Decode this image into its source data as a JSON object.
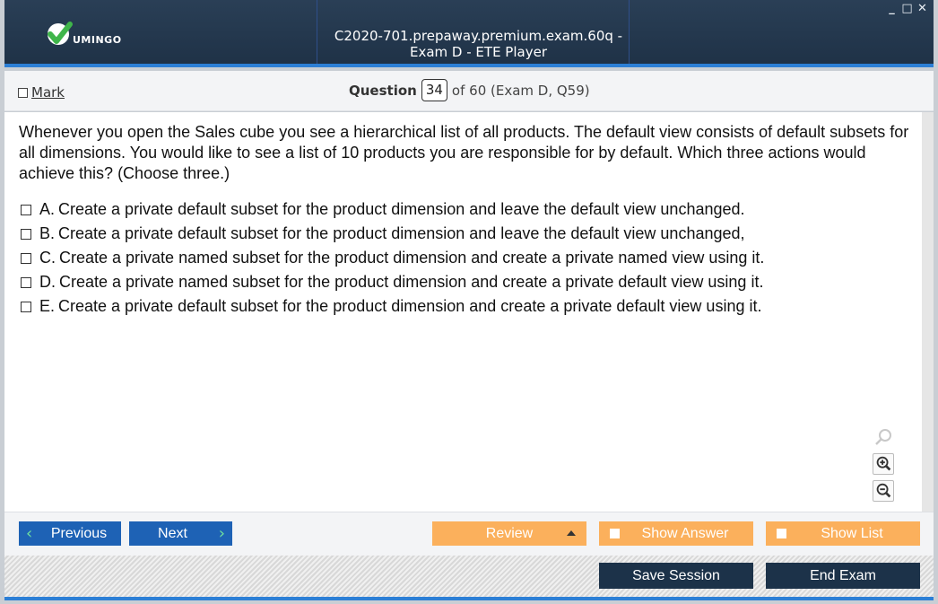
{
  "window": {
    "title": "C2020-701.prepaway.premium.exam.60q - Exam D - ETE Player",
    "logo_text": "UMINGO",
    "controls": {
      "minimize": "_",
      "maximize": "□",
      "close": "✕"
    }
  },
  "header": {
    "mark_label": "Mark",
    "question_label": "Question",
    "question_number": "34",
    "question_of": "of 60 (Exam D, Q59)"
  },
  "question": {
    "text": "Whenever you open the Sales cube you see a hierarchical list of all products. The default view consists of default subsets for all dimensions. You would like to see a list of 10 products you are responsible for by default. Which three actions would achieve this? (Choose three.)",
    "options": [
      {
        "letter": "A.",
        "text": "Create a private default subset for the product dimension and leave the default view unchanged."
      },
      {
        "letter": "B.",
        "text": "Create a private default subset for the product dimension and leave the default view unchanged,"
      },
      {
        "letter": "C.",
        "text": "Create a private named subset for the product dimension and create a private named view using it."
      },
      {
        "letter": "D.",
        "text": "Create a private named subset for the product dimension and create a private default view using it."
      },
      {
        "letter": "E.",
        "text": "Create a private default subset for the product dimension and create a private default view using it."
      }
    ]
  },
  "nav": {
    "previous_label": "Previous",
    "next_label": "Next",
    "review_label": "Review",
    "show_answer_label": "Show Answer",
    "show_list_label": "Show List",
    "save_session_label": "Save Session",
    "end_exam_label": "End Exam"
  },
  "colors": {
    "title_bar": "#1f3247",
    "accent_blue": "#1e62b5",
    "orange": "#fbb05c",
    "dark_button": "#1c3249",
    "chevron_green": "#6fe19e"
  },
  "icons": [
    "check-logo-icon",
    "search-icon",
    "zoom-in-icon",
    "zoom-out-icon",
    "chevron-left-icon",
    "chevron-right-icon",
    "caret-up-icon"
  ]
}
